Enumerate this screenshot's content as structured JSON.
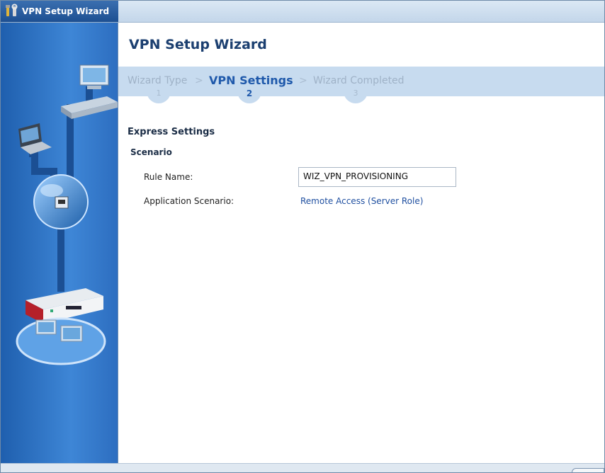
{
  "window": {
    "title": "VPN Setup Wizard",
    "icon": "tools-icon"
  },
  "header": {
    "title": "VPN Setup Wizard"
  },
  "steps": [
    {
      "label": "Wizard Type",
      "number": "1",
      "active": false
    },
    {
      "label": "VPN Settings",
      "number": "2",
      "active": true
    },
    {
      "label": "Wizard Completed",
      "number": "3",
      "active": false
    }
  ],
  "separator": ">",
  "express": {
    "heading": "Express Settings",
    "scenario_heading": "Scenario",
    "rule_name_label": "Rule Name:",
    "rule_name_value": "WIZ_VPN_PROVISIONING",
    "app_scenario_label": "Application Scenario:",
    "app_scenario_value": "Remote Access (Server Role)"
  },
  "colors": {
    "sidebar": "#2d6ec0",
    "accent": "#1f59ab",
    "steps_bar": "#c7dbef"
  }
}
